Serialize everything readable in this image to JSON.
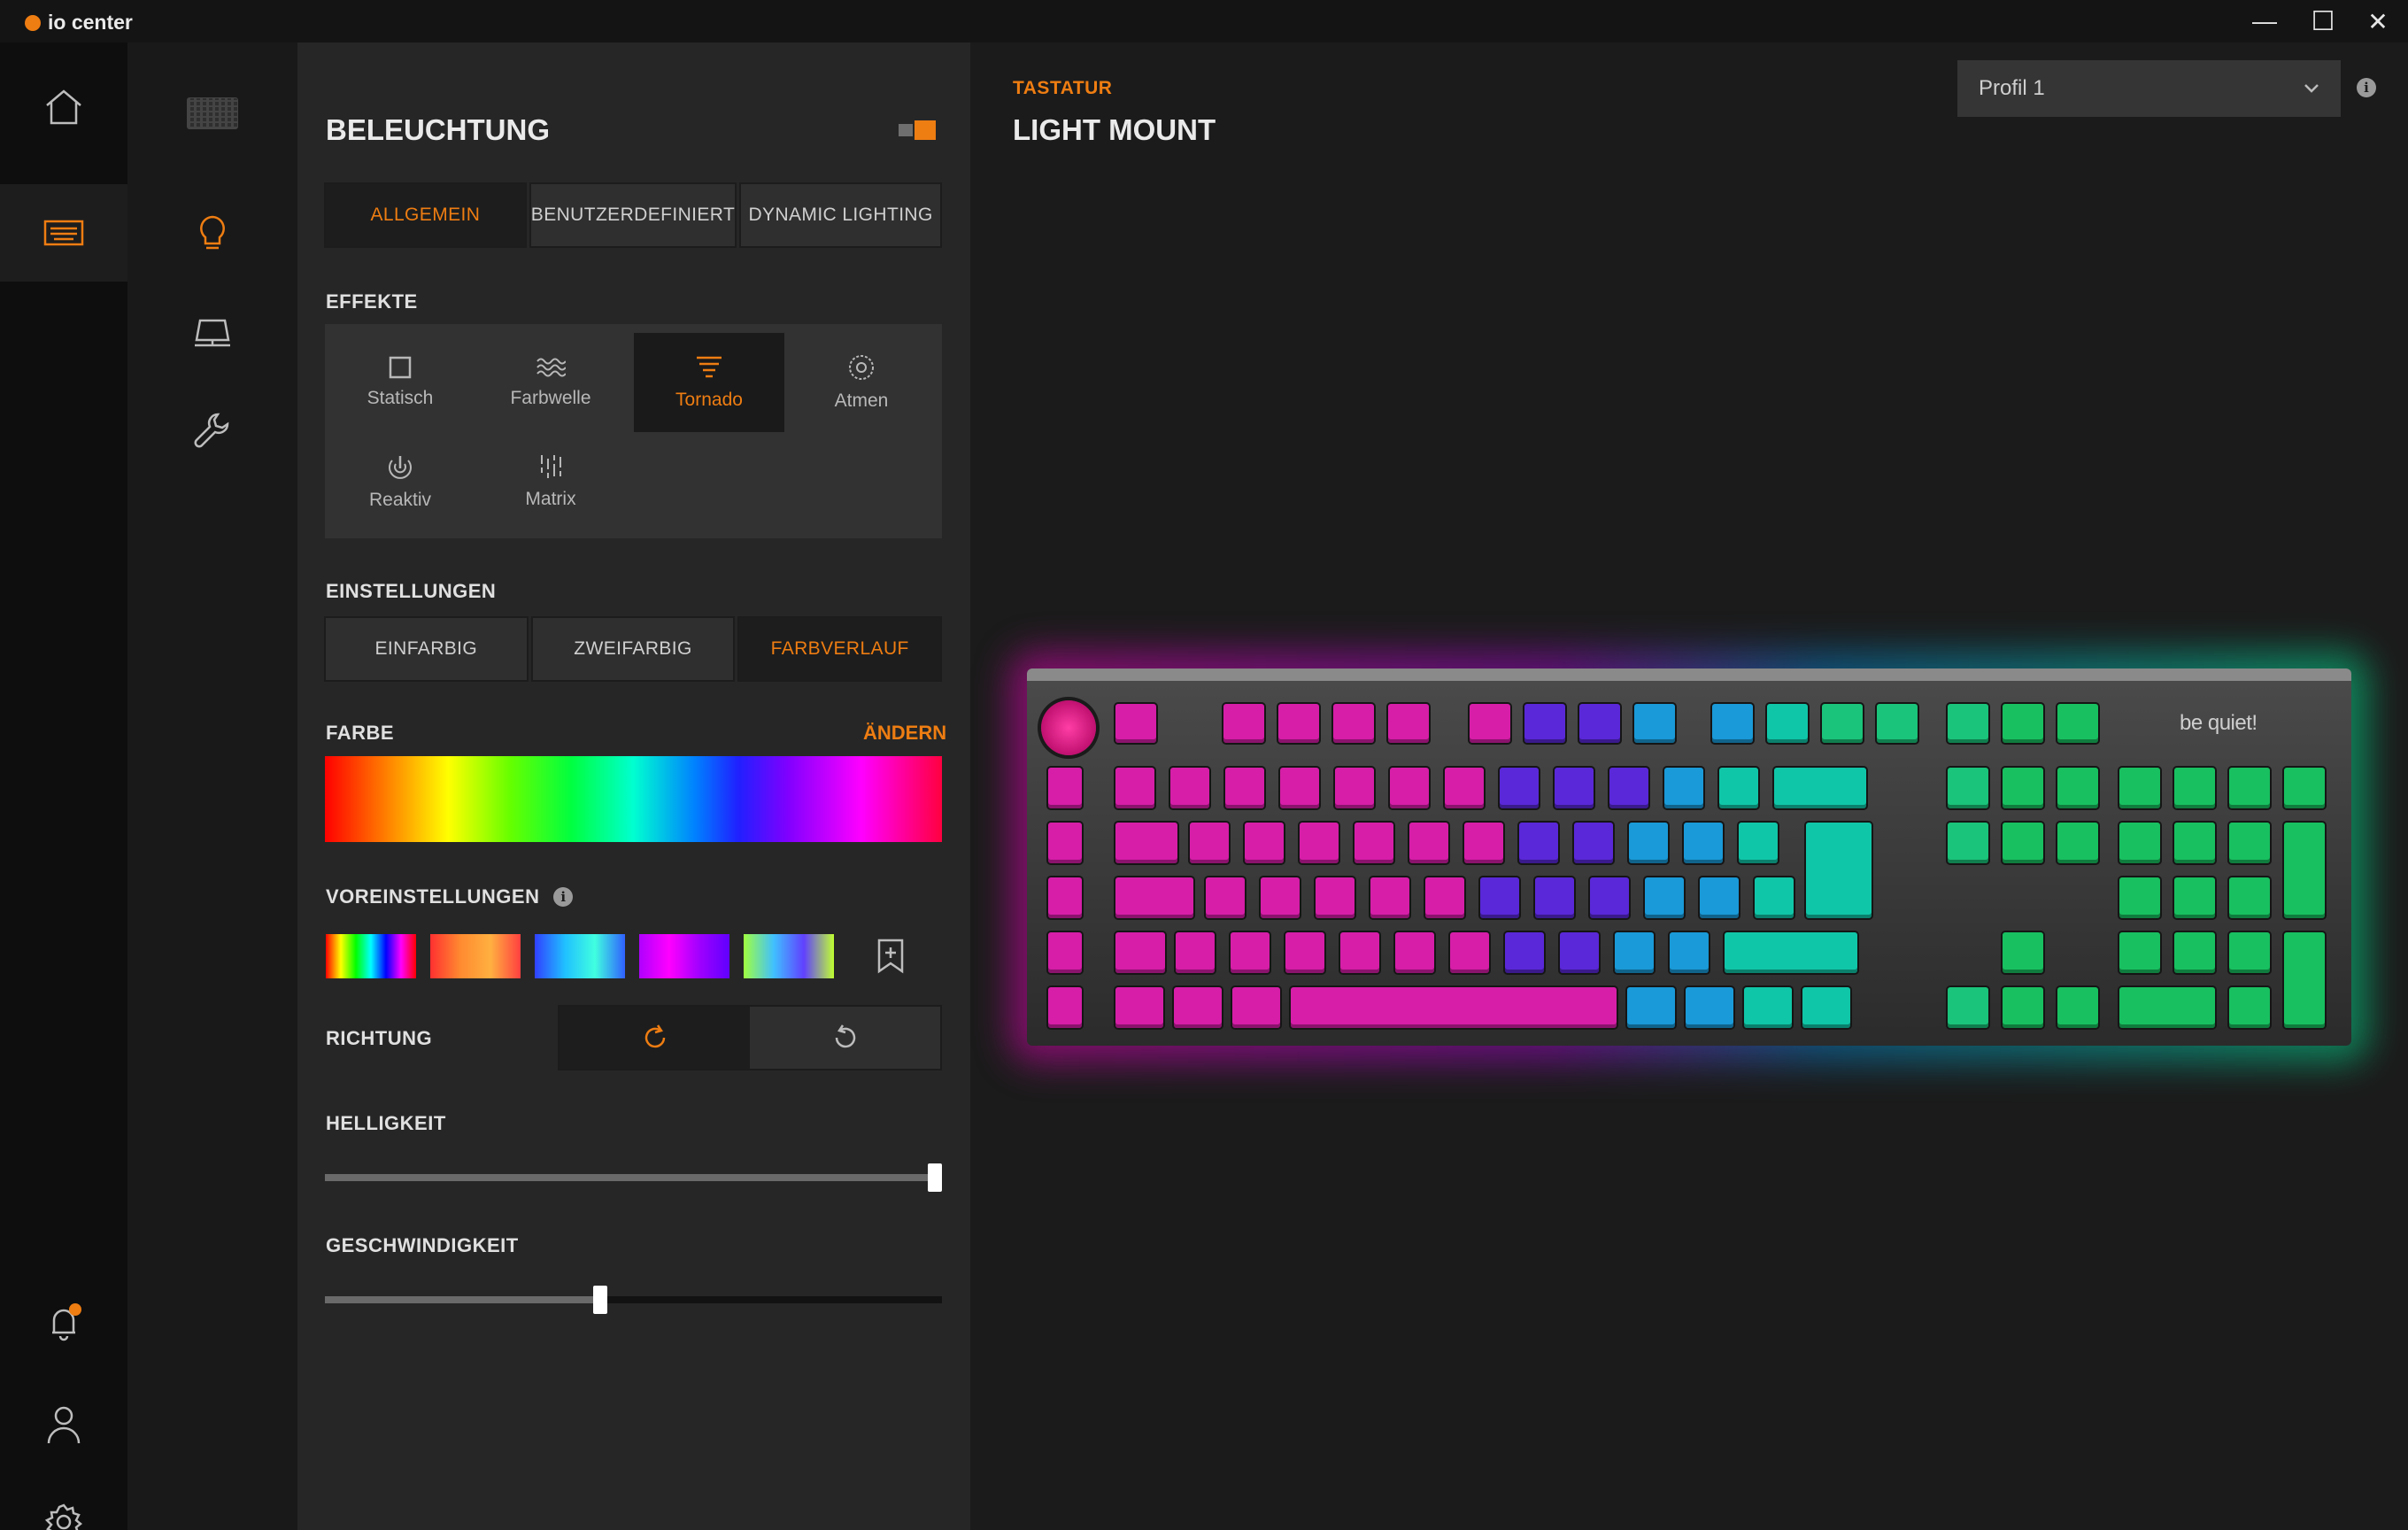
{
  "app": {
    "title": "io center"
  },
  "window_controls": {
    "minimize": "—",
    "maximize": "☐",
    "close": "✕"
  },
  "nav": {
    "rail1": [
      "home-icon",
      "keyboard-icon",
      "notification-bell-icon",
      "user-icon",
      "settings-gear-icon"
    ],
    "rail2": [
      "keyboard-thumbnail",
      "lightbulb-icon",
      "laptop-icon",
      "wrench-icon"
    ],
    "notification_dot_color": "#ee7d12"
  },
  "lighting": {
    "title": "BELEUCHTUNG",
    "tabs": [
      {
        "label": "ALLGEMEIN",
        "active": true
      },
      {
        "label": "BENUTZERDEFINIERT",
        "active": false
      },
      {
        "label": "DYNAMIC LIGHTING",
        "active": false
      }
    ],
    "effects_heading": "EFFEKTE",
    "effects": [
      {
        "label": "Statisch",
        "icon": "square-icon",
        "active": false
      },
      {
        "label": "Farbwelle",
        "icon": "wave-icon",
        "active": false
      },
      {
        "label": "Tornado",
        "icon": "tornado-icon",
        "active": true
      },
      {
        "label": "Atmen",
        "icon": "breathing-icon",
        "active": false
      },
      {
        "label": "Reaktiv",
        "icon": "reactive-icon",
        "active": false
      },
      {
        "label": "Matrix",
        "icon": "matrix-icon",
        "active": false
      }
    ],
    "settings_heading": "EINSTELLUNGEN",
    "color_modes": [
      {
        "label": "EINFARBIG",
        "active": false
      },
      {
        "label": "ZWEIFARBIG",
        "active": false
      },
      {
        "label": "FARBVERLAUF",
        "active": true
      }
    ],
    "color_heading": "FARBE",
    "change_label": "ÄNDERN",
    "presets_heading": "VOREINSTELLUNGEN",
    "presets": [
      {
        "name": "rainbow",
        "gradient": [
          "#ff0000",
          "#ffff00",
          "#00ff00",
          "#00ffff",
          "#0000ff",
          "#ff00ff",
          "#ff0000"
        ]
      },
      {
        "name": "sunset",
        "gradient": [
          "#ff3030",
          "#ff8a30",
          "#ffb040",
          "#ff4040"
        ]
      },
      {
        "name": "ocean",
        "gradient": [
          "#3040ff",
          "#20c0ff",
          "#40ffe0",
          "#3060ff"
        ]
      },
      {
        "name": "violet",
        "gradient": [
          "#b000ff",
          "#ff00ff",
          "#a000ff",
          "#6000ff"
        ]
      },
      {
        "name": "aurora",
        "gradient": [
          "#a0ff40",
          "#40c0ff",
          "#6040ff",
          "#c0ff30"
        ]
      }
    ],
    "direction_heading": "RICHTUNG",
    "directions": [
      {
        "icon": "rotate-clockwise-icon",
        "active": true
      },
      {
        "icon": "rotate-counterclockwise-icon",
        "active": false
      }
    ],
    "brightness_heading": "HELLIGKEIT",
    "brightness": 1.0,
    "speed_heading": "GESCHWINDIGKEIT",
    "speed": 0.445
  },
  "device": {
    "category": "TASTATUR",
    "name": "LIGHT MOUNT",
    "brand": "be quiet!"
  },
  "profile": {
    "selected": "Profil 1"
  },
  "colors": {
    "accent": "#ee7d12"
  }
}
